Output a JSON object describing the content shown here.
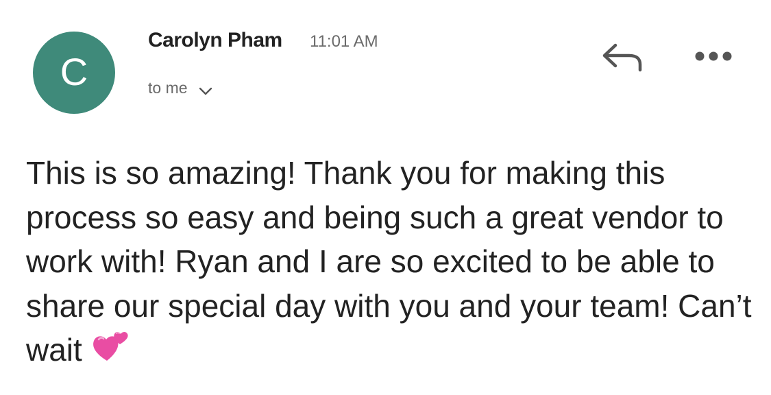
{
  "sender": {
    "initial": "C",
    "name": "Carolyn Pham",
    "time": "11:01 AM",
    "avatar_color": "#3f8a7a"
  },
  "recipient": {
    "label": "to me",
    "expand_icon": "chevron-down-icon"
  },
  "actions": {
    "reply_icon": "reply-icon",
    "more_icon": "more-horizontal-icon"
  },
  "message": {
    "body": "This is so amazing! Thank you for making this process so easy and being such a great vendor to work with! Ryan and I are so excited to be able to share our special day with you and your team! Can’t wait",
    "emoji": "two-hearts-emoji"
  },
  "colors": {
    "text": "#222222",
    "muted": "#6b6b6b",
    "icon": "#555555",
    "heart": "#e94da3"
  }
}
